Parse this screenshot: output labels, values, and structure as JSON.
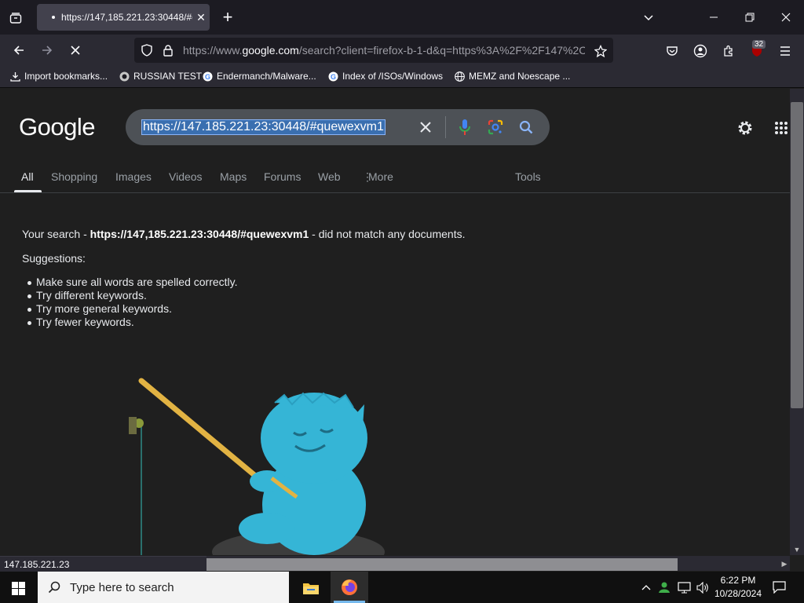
{
  "browser": {
    "tab_title": "https://147,185.221.23:30448/#q",
    "url_prefix": "https://www.",
    "url_domain": "google.com",
    "url_rest": "/search?client=firefox-b-1-d&q=https%3A%2F%2F147%2C",
    "extension_badge": "32",
    "bookmarks": [
      {
        "label": "Import bookmarks..."
      },
      {
        "label": "RUSSIAN TEST"
      },
      {
        "label": "Endermanch/Malware..."
      },
      {
        "label": "Index of /ISOs/Windows"
      },
      {
        "label": "MEMZ and Noescape ..."
      }
    ],
    "status_text": "147.185.221.23"
  },
  "google": {
    "logo": "Google",
    "search_query": "https://147.185.221.23:30448/#quewexvm1",
    "tabs": [
      {
        "label": "All"
      },
      {
        "label": "Shopping"
      },
      {
        "label": "Images"
      },
      {
        "label": "Videos"
      },
      {
        "label": "Maps"
      },
      {
        "label": "Forums"
      },
      {
        "label": "Web"
      },
      {
        "label": "More"
      }
    ],
    "tools_label": "Tools",
    "result": {
      "prefix": "Your search - ",
      "query": "https://147,185.221.23:30448/#quewexvm1",
      "suffix": " - did not match any documents."
    },
    "suggestions_title": "Suggestions:",
    "suggestions": [
      "Make sure all words are spelled correctly.",
      "Try different keywords.",
      "Try more general keywords.",
      "Try fewer keywords."
    ]
  },
  "taskbar": {
    "search_placeholder": "Type here to search",
    "time": "6:22 PM",
    "date": "10/28/2024"
  },
  "colors": {
    "accent_blue": "#8ab4f8",
    "page_bg": "#1f1f1f",
    "mascot": "#35b5d6"
  }
}
